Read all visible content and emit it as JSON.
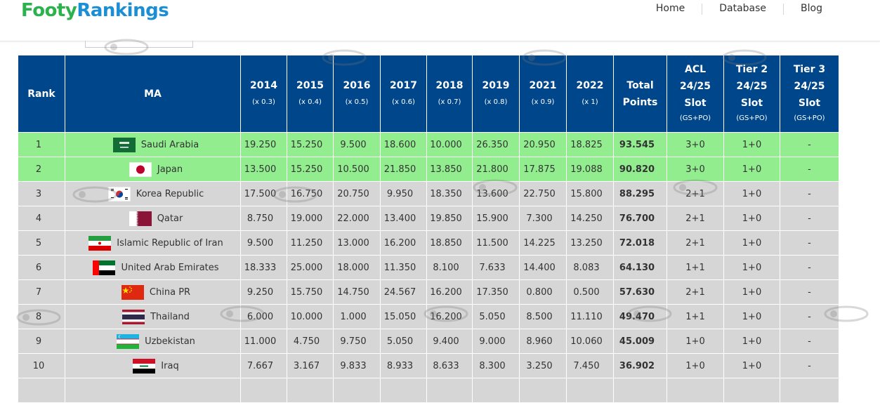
{
  "brand": {
    "part1": "Footy",
    "part2": "Rankings"
  },
  "nav": {
    "home": "Home",
    "database": "Database",
    "blog": "Blog"
  },
  "table": {
    "headers": {
      "rank": "Rank",
      "ma": "MA",
      "years": [
        {
          "year": "2014",
          "coef": "(x 0.3)"
        },
        {
          "year": "2015",
          "coef": "(x 0.4)"
        },
        {
          "year": "2016",
          "coef": "(x 0.5)"
        },
        {
          "year": "2017",
          "coef": "(x 0.6)"
        },
        {
          "year": "2018",
          "coef": "(x 0.7)"
        },
        {
          "year": "2019",
          "coef": "(x 0.8)"
        },
        {
          "year": "2021",
          "coef": "(x 0.9)"
        },
        {
          "year": "2022",
          "coef": "(x 1)"
        }
      ],
      "total_line1": "Total",
      "total_line2": "Points",
      "acl": {
        "l1": "ACL",
        "l2": "24/25",
        "l3": "Slot",
        "sub": "(GS+PO)"
      },
      "tier2": {
        "l1": "Tier 2",
        "l2": "24/25",
        "l3": "Slot",
        "sub": "(GS+PO)"
      },
      "tier3": {
        "l1": "Tier 3",
        "l2": "24/25",
        "l3": "Slot",
        "sub": "(GS+PO)"
      }
    },
    "rows": [
      {
        "rank": "1",
        "country": "Saudi Arabia",
        "flag": "saudi-arabia-flag-icon",
        "values": [
          "19.250",
          "15.250",
          "9.500",
          "18.600",
          "10.000",
          "26.350",
          "20.950",
          "18.825"
        ],
        "total": "93.545",
        "acl": "3+0",
        "tier2": "1+0",
        "tier3": "-",
        "highlight": true
      },
      {
        "rank": "2",
        "country": "Japan",
        "flag": "japan-flag-icon",
        "values": [
          "13.500",
          "15.250",
          "10.500",
          "21.850",
          "13.850",
          "21.800",
          "17.875",
          "19.088"
        ],
        "total": "90.820",
        "acl": "3+0",
        "tier2": "1+0",
        "tier3": "-",
        "highlight": true
      },
      {
        "rank": "3",
        "country": "Korea Republic",
        "flag": "korea-republic-flag-icon",
        "values": [
          "17.500",
          "16.750",
          "20.750",
          "9.950",
          "18.350",
          "13.600",
          "22.750",
          "15.800"
        ],
        "total": "88.295",
        "acl": "2+1",
        "tier2": "1+0",
        "tier3": "-",
        "highlight": false
      },
      {
        "rank": "4",
        "country": "Qatar",
        "flag": "qatar-flag-icon",
        "values": [
          "8.750",
          "19.000",
          "22.000",
          "13.400",
          "19.850",
          "15.900",
          "7.300",
          "14.250"
        ],
        "total": "76.700",
        "acl": "2+1",
        "tier2": "1+0",
        "tier3": "-",
        "highlight": false
      },
      {
        "rank": "5",
        "country": "Islamic Republic of Iran",
        "flag": "iran-flag-icon",
        "values": [
          "9.500",
          "11.250",
          "13.000",
          "16.200",
          "18.850",
          "11.500",
          "14.225",
          "13.250"
        ],
        "total": "72.018",
        "acl": "2+1",
        "tier2": "1+0",
        "tier3": "-",
        "highlight": false
      },
      {
        "rank": "6",
        "country": "United Arab Emirates",
        "flag": "uae-flag-icon",
        "values": [
          "18.333",
          "25.000",
          "18.000",
          "11.350",
          "8.100",
          "7.633",
          "14.400",
          "8.083"
        ],
        "total": "64.130",
        "acl": "1+1",
        "tier2": "1+0",
        "tier3": "-",
        "highlight": false
      },
      {
        "rank": "7",
        "country": "China PR",
        "flag": "china-flag-icon",
        "values": [
          "9.250",
          "15.750",
          "14.750",
          "24.567",
          "16.200",
          "17.350",
          "0.800",
          "0.500"
        ],
        "total": "57.630",
        "acl": "2+1",
        "tier2": "1+0",
        "tier3": "-",
        "highlight": false
      },
      {
        "rank": "8",
        "country": "Thailand",
        "flag": "thailand-flag-icon",
        "values": [
          "6.000",
          "10.000",
          "1.000",
          "15.050",
          "16.200",
          "5.050",
          "8.500",
          "11.110"
        ],
        "total": "49.470",
        "acl": "1+1",
        "tier2": "1+0",
        "tier3": "-",
        "highlight": false
      },
      {
        "rank": "9",
        "country": "Uzbekistan",
        "flag": "uzbekistan-flag-icon",
        "values": [
          "11.000",
          "4.750",
          "9.750",
          "5.050",
          "9.400",
          "9.000",
          "8.960",
          "10.060"
        ],
        "total": "45.009",
        "acl": "1+0",
        "tier2": "1+0",
        "tier3": "-",
        "highlight": false
      },
      {
        "rank": "10",
        "country": "Iraq",
        "flag": "iraq-flag-icon",
        "values": [
          "7.667",
          "3.167",
          "9.833",
          "8.933",
          "8.633",
          "8.300",
          "3.250",
          "7.450"
        ],
        "total": "36.902",
        "acl": "1+0",
        "tier2": "1+0",
        "tier3": "-",
        "highlight": false
      }
    ]
  },
  "colors": {
    "header_bg": "#00468a",
    "highlight_row": "#92ed8f",
    "normal_row": "#d6d6d6",
    "brand_green": "#2bb24c",
    "brand_blue": "#1b8fd6"
  }
}
